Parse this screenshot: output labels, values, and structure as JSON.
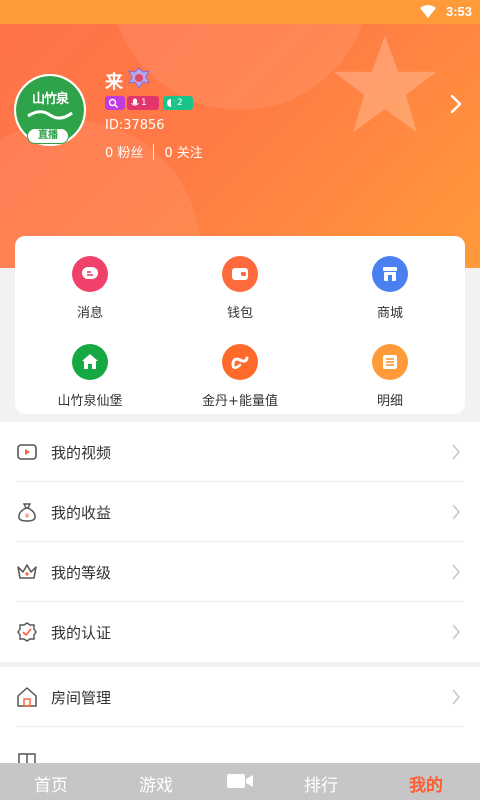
{
  "status_bar": {
    "time": "3:53"
  },
  "profile": {
    "avatar_text": "山竹泉",
    "live_badge": "直播",
    "username": "来",
    "badges": [
      {
        "icon": "search-icon",
        "text": ""
      },
      {
        "icon": "mic-icon",
        "text": "1"
      },
      {
        "icon": "moon-icon",
        "text": "2"
      }
    ],
    "uid": "ID:37856",
    "fans": "0 粉丝",
    "following": "0 关注"
  },
  "grid": [
    {
      "label": "消息",
      "icon": "message-icon",
      "color": "#f0416a"
    },
    {
      "label": "钱包",
      "icon": "wallet-icon",
      "color": "#ff6a3c"
    },
    {
      "label": "商城",
      "icon": "shop-icon",
      "color": "#4a7ff0"
    },
    {
      "label": "山竹泉仙堡",
      "icon": "home-icon",
      "color": "#16a843"
    },
    {
      "label": "金丹+能量值",
      "icon": "energy-icon",
      "color": "#ff6a2a"
    },
    {
      "label": "明细",
      "icon": "list-icon",
      "color": "#ff9a3a"
    }
  ],
  "menu1": [
    {
      "label": "我的视频",
      "icon": "video-icon"
    },
    {
      "label": "我的收益",
      "icon": "money-bag-icon"
    },
    {
      "label": "我的等级",
      "icon": "crown-icon"
    },
    {
      "label": "我的认证",
      "icon": "verified-icon"
    }
  ],
  "menu2": [
    {
      "label": "房间管理",
      "icon": "house-icon"
    },
    {
      "label": "",
      "icon": "gift-icon"
    }
  ],
  "tabs": {
    "home": "首页",
    "game": "游戏",
    "rank": "排行",
    "mine": "我的"
  },
  "colors": {
    "accent": "#ff5d32",
    "header_start": "#ff7149",
    "header_end": "#ff9a3a"
  }
}
